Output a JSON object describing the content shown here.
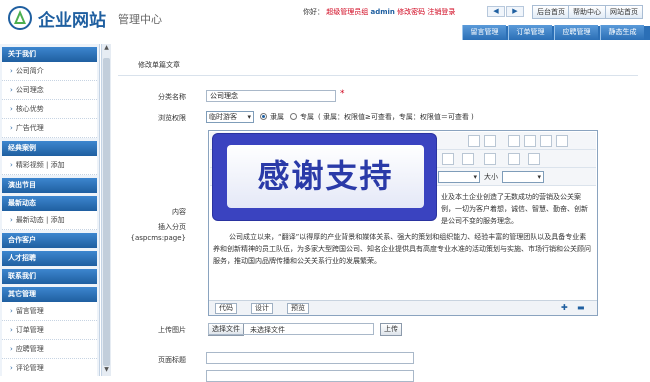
{
  "header": {
    "logo_title": "企业网站",
    "logo_subtitle": "管理中心",
    "greeting": "你好：",
    "role": "超级管理员组",
    "username": "admin",
    "change_password": "修改密码",
    "logout": "注销登录",
    "ctrl_prev": "◀",
    "ctrl_next": "▶",
    "btn_admin_home": "后台首页",
    "btn_help_center": "帮助中心",
    "btn_site_home": "网站首页",
    "tabs": [
      "留言管理",
      "订单管理",
      "应聘管理",
      "静态生成"
    ]
  },
  "sidebar": {
    "sections": [
      {
        "title": "关于我们",
        "items": [
          "公司简介",
          "公司理念",
          "核心优势",
          "广告代理"
        ]
      },
      {
        "title": "经典案例",
        "items": [
          "精彩视频 | 添加"
        ]
      },
      {
        "title": "演出节目",
        "items": []
      },
      {
        "title": "最新动态",
        "items": [
          "最新动态 | 添加"
        ]
      },
      {
        "title": "合作客户",
        "items": []
      },
      {
        "title": "人才招聘",
        "items": []
      },
      {
        "title": "联系我们",
        "items": []
      },
      {
        "title": "其它管理",
        "items": [
          "留言管理",
          "订单管理",
          "应聘管理",
          "评论管理"
        ]
      }
    ]
  },
  "form": {
    "section_title": "修改单篇文章",
    "category_label": "分类名称",
    "category_value": "公司理念",
    "permission_label": "浏览权限",
    "permission_select": "临时游客",
    "radio_exclusive": "隶属",
    "radio_special": "专属",
    "permission_note": "( 隶属：权限值≥可查看，专属：权限值＝可查看 )",
    "content_label": "内容",
    "paging_label": "插入分页",
    "paging_tag": "{aspcms:page}",
    "font_size_label": "大小",
    "editor_text": "业及本土企业创造了无数成功的营销及公关案例，一切为客户着想，诚信、智慧、勤奋、创新是公司不变的服务理念。",
    "editor_paragraph": "公司成立以来，“翻译”以得厚的产业背景和媒体关系、强大的策划和组织能力、经验丰富的管理团队以及具备专业素养和创新精神的员工队伍，为多家大型跨国公司、知名企业提供具有高度专业水准的活动策划与实施、市场行销和公关顾问服务，推动国内品牌传播和公关关系行业的发展繁荣。",
    "mode_code": "代码",
    "mode_design": "设计",
    "mode_preview": "预览",
    "upload_label": "上传图片",
    "choose_file": "选择文件",
    "no_file": "未选择文件",
    "upload_button": "上传",
    "page_title_label": "页面标题"
  },
  "overlay": {
    "text": "感谢支持"
  }
}
